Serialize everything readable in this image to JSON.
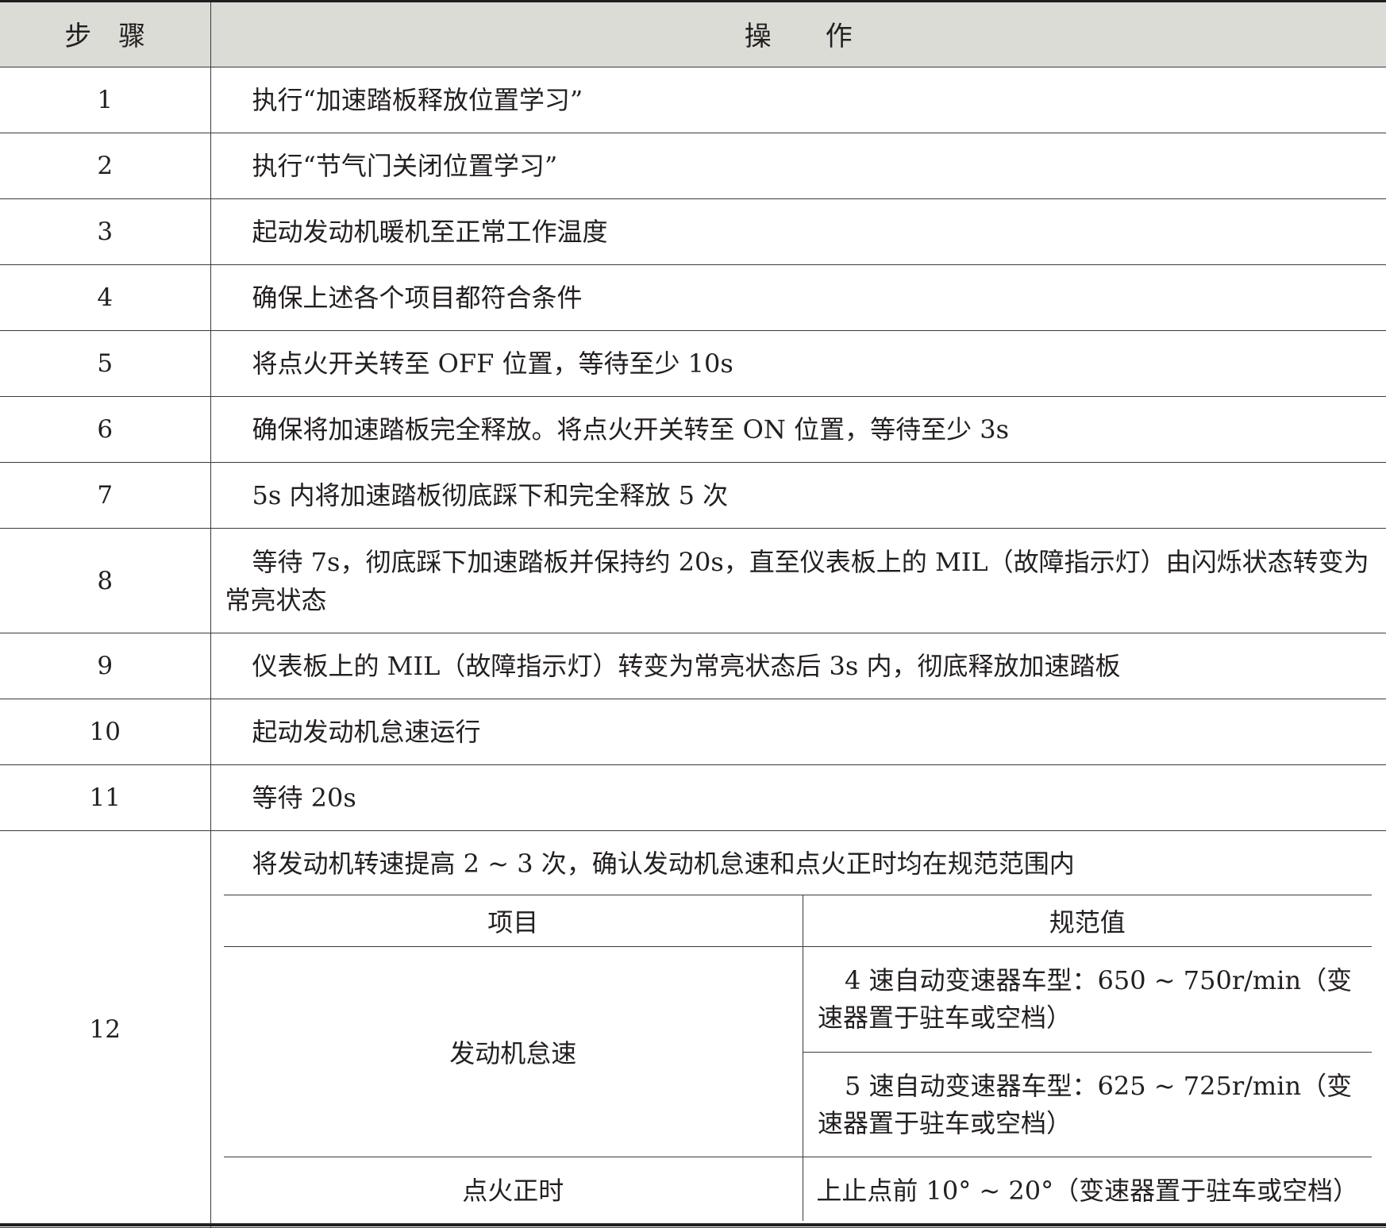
{
  "header": {
    "step_label": "步　骤",
    "operation_label": "操　　作"
  },
  "steps": [
    {
      "no": "1",
      "text": "执行“加速踏板释放位置学习”"
    },
    {
      "no": "2",
      "text": "执行“节气门关闭位置学习”"
    },
    {
      "no": "3",
      "text": "起动发动机暖机至正常工作温度"
    },
    {
      "no": "4",
      "text": "确保上述各个项目都符合条件"
    },
    {
      "no": "5",
      "text": "将点火开关转至 OFF 位置，等待至少 10s"
    },
    {
      "no": "6",
      "text": "确保将加速踏板完全释放。将点火开关转至 ON 位置，等待至少 3s"
    },
    {
      "no": "7",
      "text": "5s 内将加速踏板彻底踩下和完全释放 5 次"
    },
    {
      "no": "8",
      "text": "等待 7s，彻底踩下加速踏板并保持约 20s，直至仪表板上的 MIL（故障指示灯）由闪烁状态转变为常亮状态"
    },
    {
      "no": "9",
      "text": "仪表板上的 MIL（故障指示灯）转变为常亮状态后 3s 内，彻底释放加速踏板"
    },
    {
      "no": "10",
      "text": "起动发动机怠速运行"
    },
    {
      "no": "11",
      "text": "等待 20s"
    }
  ],
  "step12": {
    "no": "12",
    "text": "将发动机转速提高 2 ~ 3 次，确认发动机怠速和点火正时均在规范范围内",
    "spec_table": {
      "col_item": "项目",
      "col_value": "规范值",
      "idle_label": "发动机怠速",
      "idle_4speed": "4 速自动变速器车型：650 ~ 750r/min（变速器置于驻车或空档）",
      "idle_5speed": "5 速自动变速器车型：625 ~ 725r/min（变速器置于驻车或空档）",
      "timing_label": "点火正时",
      "timing_value": "上止点前 10° ~ 20°（变速器置于驻车或空档）"
    }
  }
}
